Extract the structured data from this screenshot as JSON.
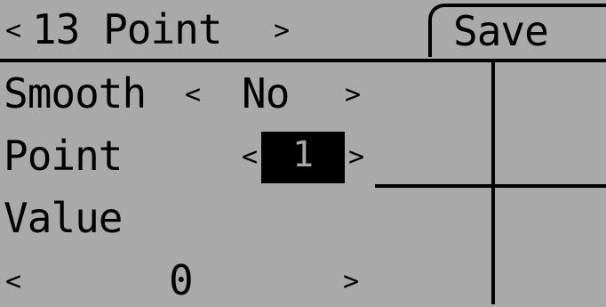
{
  "header": {
    "curve_prev": "<",
    "curve_title": "13 Point",
    "curve_next": ">",
    "save_label": "Save"
  },
  "rows": {
    "smooth": {
      "label": "Smooth",
      "prev": "<",
      "value": "No",
      "next": ">"
    },
    "point": {
      "label": "Point",
      "prev": "<",
      "value": "1",
      "next": ">"
    },
    "value": {
      "label": "Value",
      "prev": "<",
      "value": "0",
      "next": ">"
    }
  },
  "colors": {
    "lcd_background": "#a9a9a9",
    "lcd_foreground": "#000000"
  }
}
